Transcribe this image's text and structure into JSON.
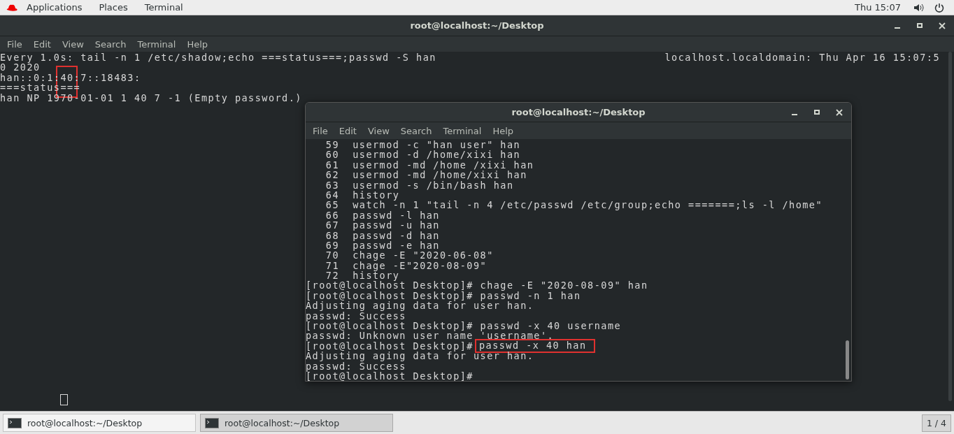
{
  "top_bar": {
    "menus": [
      "Applications",
      "Places",
      "Terminal"
    ],
    "clock": "Thu 15:07"
  },
  "main_window": {
    "title": "root@localhost:~/Desktop",
    "menu": [
      "File",
      "Edit",
      "View",
      "Search",
      "Terminal",
      "Help"
    ],
    "header_left": "Every 1.0s: tail -n 1 /etc/shadow;echo ===status===;passwd -S han",
    "header_right": "localhost.localdomain: Thu Apr 16 15:07:5",
    "lines": [
      "0 2020",
      "han::0:1:40:7::18483:",
      "===status===",
      "han NP 1970-01-01 1 40 7 -1 (Empty password.)"
    ]
  },
  "front_window": {
    "title": "root@localhost:~/Desktop",
    "menu": [
      "File",
      "Edit",
      "View",
      "Search",
      "Terminal",
      "Help"
    ],
    "lines": [
      "   59  usermod -c \"han user\" han",
      "   60  usermod -d /home/xixi han",
      "   61  usermod -md /home /xixi han",
      "   62  usermod -md /home/xixi han",
      "   63  usermod -s /bin/bash han",
      "   64  history",
      "   65  watch -n 1 \"tail -n 4 /etc/passwd /etc/group;echo =======;ls -l /home\"",
      "   66  passwd -l han",
      "   67  passwd -u han",
      "   68  passwd -d han",
      "   69  passwd -e han",
      "   70  chage -E \"2020-06-08\"",
      "   71  chage -E\"2020-08-09\"",
      "   72  history",
      "[root@localhost Desktop]# chage -E \"2020-08-09\" han",
      "[root@localhost Desktop]# passwd -n 1 han",
      "Adjusting aging data for user han.",
      "passwd: Success",
      "[root@localhost Desktop]# passwd -x 40 username",
      "passwd: Unknown user name 'username'.",
      {
        "kind": "marked",
        "prompt": "[root@localhost Desktop]#",
        "command": "passwd -x 40 han"
      },
      "Adjusting aging data for user han.",
      "passwd: Success",
      "[root@localhost Desktop]#"
    ]
  },
  "taskbar": {
    "items": [
      {
        "label": "root@localhost:~/Desktop",
        "selected": false
      },
      {
        "label": "root@localhost:~/Desktop",
        "selected": true
      }
    ],
    "pager": "1 / 4"
  }
}
